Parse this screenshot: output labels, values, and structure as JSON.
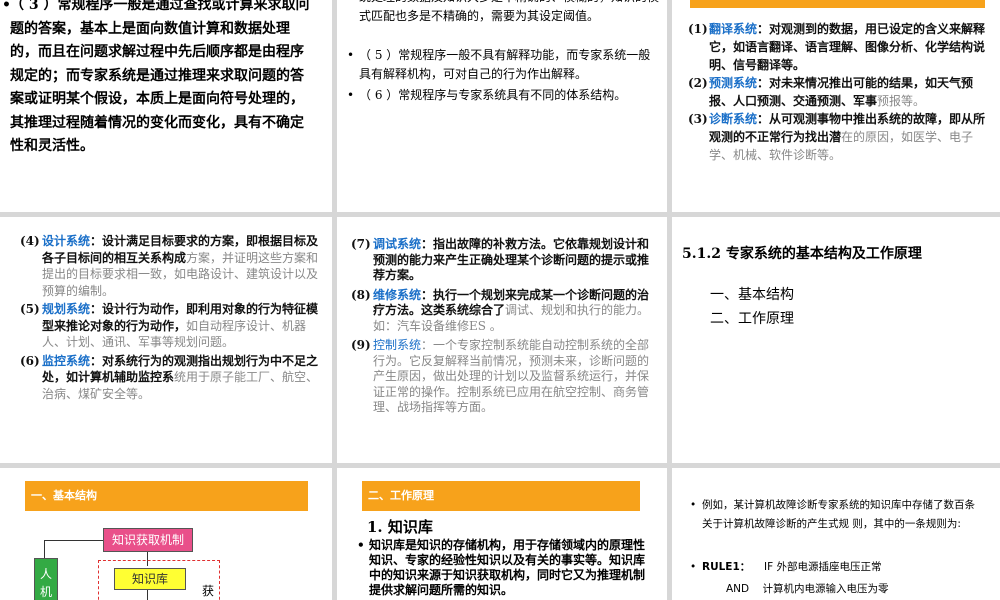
{
  "slide1": {
    "text": "（ 3 ）常规程序一般是通过查找或计算来求取问题的答案，基本上是面向数值计算和数据处理的，而且在问题求解过程中先后顺序都是由程序规定的；而专家系统是通过推理来求取问题的答案或证明某个假设，本质上是面向符号处理的，其推理过程随着情况的变化而变化，具有不确定性和灵活性。"
  },
  "slide2": {
    "partial": "统处理的数据及知识大多是不精确的、模糊的，知识的模式匹配也多是不精确的，需要为其设定阈值。",
    "b1": "（ 5 ）常规程序一般不具有解释功能，而专家系统一般具有解释机构，可对自己的行为作出解释。",
    "b2": "（ 6 ）常规程序与专家系统具有不同的体系结构。"
  },
  "slide3": {
    "i1": {
      "num": "(1)",
      "term": "翻译系统",
      "bold": "：对观测到的数据，用已设定的含义来解释它，如语言翻译、语言理解、图像分析、化学结构说明、信号翻译等。",
      "gray": ""
    },
    "i2": {
      "num": "(2)",
      "term": "预测系统",
      "bold": "：对未来情况推出可能的结果，如天气预报、人口预测、交通预测、军事",
      "gray": "预报等。"
    },
    "i3": {
      "num": "(3)",
      "term": "诊断系统",
      "bold": "：从可观测事物中推出系统的故障，即从所观测的不正常行为找出潜",
      "gray": "在的原因，如医学、电子学、机械、软件诊断等。"
    }
  },
  "slide4": {
    "i4": {
      "num": "(4)",
      "term": "设计系统",
      "bold": "：设计满足目标要求的方案，即根据目标及各子目标间的相互关系构成",
      "gray": "方案，并证明这些方案和提出的目标要求相一致，如电路设计、建筑设计以及预算的编制。"
    },
    "i5": {
      "num": "(5)",
      "term": "规划系统",
      "bold": "：设计行为动作，即利用对象的行为特征模型来推论对象的行为动作，",
      "gray": "如自动程序设计、机器人、计划、通讯、军事等规划问题。"
    },
    "i6": {
      "num": "(6)",
      "term": "监控系统",
      "bold": "：对系统行为的观测指出规划行为中不足之处，如计算机辅助监控系",
      "gray": "统用于原子能工厂、航空、治病、煤矿安全等。"
    }
  },
  "slide5": {
    "i7": {
      "num": "(7)",
      "term": "调试系统",
      "bold": "：指出故障的补救方法。它依靠规划设计和预测的能力来产生正确处理某个诊断问题的提示或推荐方案。",
      "gray": ""
    },
    "i8": {
      "num": "(8)",
      "term": "维修系统",
      "bold": "：执行一个规划来完成某一个诊断问题的治疗方法。这类系统综合了",
      "gray": "调试、规划和执行的能力。如：汽车设备维修ES 。"
    },
    "i9": {
      "num": "(9)",
      "term": "控制系统",
      "bold": "",
      "gray": "：一个专家控制系统能自动控制系统的全部行为。它反复解释当前情况，预测未来，诊断问题的产生原因，做出处理的计划以及监督系统运行，并保证正常的操作。控制系统已应用在航空控制、商务管理、战场指挥等方面。"
    }
  },
  "slide6": {
    "heading": "5.1.2   专家系统的基本结构及工作原理",
    "l1": "一、基本结构",
    "l2": "二、工作原理"
  },
  "slide7": {
    "banner": "一、基本结构",
    "box_acq": "知识获取机制",
    "box_kb": "知识库",
    "box_left": "人机",
    "side_char": "获"
  },
  "slide8": {
    "banner": "二、工作原理",
    "title": "1. 知识库",
    "text": "知识库是知识的存储机构，用于存储领域内的原理性知识、专家的经验性知识以及有关的事实等。知识库中的知识来源于知识获取机构，同时它又为推理机制提供求解问题所需的知识。"
  },
  "slide9": {
    "b1": "例如，某计算机故障诊断专家系统的知识库中存储了数百条关于计算机故障诊断的产生式规 则，其中的一条规则为:",
    "rule_label": "RULE1：",
    "rule_if": "IF    外部电源插座电压正常",
    "rule_and": "AND    计算机内电源输入电压为零"
  },
  "colors": {
    "background": "#d7d7d7",
    "blue_term": "#1a6fc8",
    "orange_banner": "#f7a21b",
    "pink_box": "#e9508a",
    "yellow_box": "#ffff33",
    "green_box": "#33aa44",
    "red_dash": "#e03030"
  }
}
